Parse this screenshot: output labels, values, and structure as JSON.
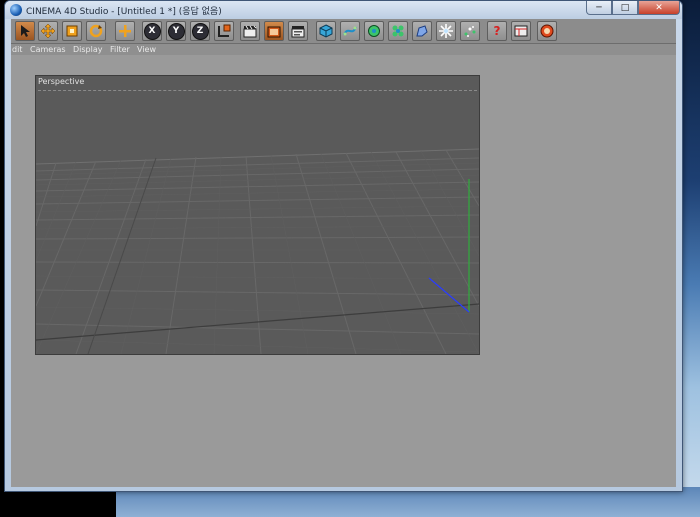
{
  "window": {
    "title": "CINEMA 4D Studio - [Untitled 1 *] (응답 없음)",
    "minimize_glyph": "─",
    "maximize_glyph": "□",
    "close_glyph": "✕"
  },
  "toolbar": {
    "axis_x": "X",
    "axis_y": "Y",
    "axis_z": "Z",
    "help_glyph": "?"
  },
  "menu": {
    "items": [
      "dit",
      "Cameras",
      "Display",
      "Filter",
      "View"
    ]
  },
  "viewport": {
    "label": "Perspective"
  },
  "colors": {
    "client_bg": "#9a9a9a",
    "viewport_bg": "#5a5a5a",
    "grid_line": "#6e6e6e",
    "axis_green": "#2fae3c",
    "axis_blue": "#2a3cff",
    "accent_orange": "#f08a1e"
  }
}
